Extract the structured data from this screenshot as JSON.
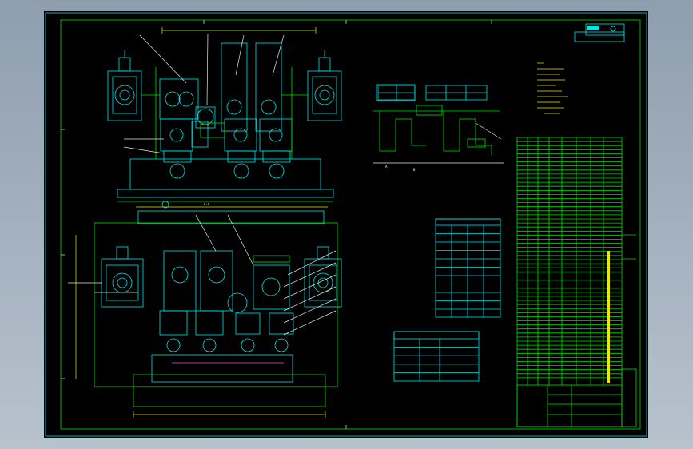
{
  "viewer": {
    "background_color": "#a3b1bf",
    "sheet_color": "#000000",
    "line_colors": {
      "outline": "#00e5e5",
      "frame": "#00e000",
      "text": "#f0f0f0",
      "dimension": "#e8e800",
      "hidden": "#3a6cff",
      "center": "#ff3b3b"
    }
  },
  "drawing": {
    "title_block_label": "",
    "tables": [
      {
        "name": "upper-spec-table",
        "rows": 2
      },
      {
        "name": "mid-spec-table",
        "rows": 11
      },
      {
        "name": "lower-spec-table",
        "rows": 5
      },
      {
        "name": "parts-list",
        "rows": 60
      }
    ],
    "views": [
      "top-roll-stand-view",
      "front-roll-stand-view",
      "side-schematic-view"
    ],
    "icons": [
      "view-number-circle-icon"
    ]
  }
}
